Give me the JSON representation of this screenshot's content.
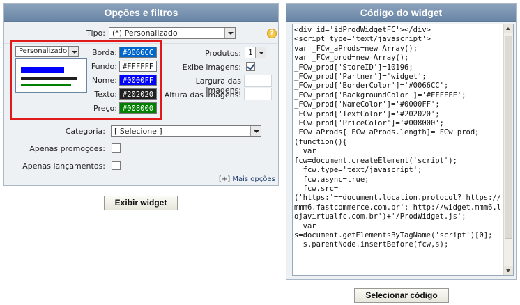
{
  "left_panel": {
    "title": "Opções e filtros",
    "tipo": {
      "label": "Tipo:",
      "value": "(*) Personalizado"
    },
    "help_icon": "?",
    "preset": {
      "value": "Personalizado"
    },
    "colors": [
      {
        "label": "Borda:",
        "value": "#0066CC",
        "hex": "#0066CC",
        "text_color": "#ffffff"
      },
      {
        "label": "Fundo:",
        "value": "#FFFFFF",
        "hex": "#FFFFFF",
        "text_color": "#111111"
      },
      {
        "label": "Nome:",
        "value": "#0000FF",
        "hex": "#0000FF",
        "text_color": "#ffffff"
      },
      {
        "label": "Texto:",
        "value": "#202020",
        "hex": "#202020",
        "text_color": "#ffffff"
      },
      {
        "label": "Preço:",
        "value": "#008000",
        "hex": "#008000",
        "text_color": "#ffffff"
      }
    ],
    "produtos": {
      "label": "Produtos:",
      "value": "1"
    },
    "exibe_imagens": {
      "label": "Exibe imagens:",
      "checked": true
    },
    "largura": {
      "label": "Largura das imagens:",
      "value": ""
    },
    "altura": {
      "label": "Altura das imagens:",
      "value": ""
    },
    "categoria": {
      "label": "Categoria:",
      "value": "[ Selecione ]"
    },
    "apenas_promocoes": {
      "label": "Apenas promoções:",
      "checked": false
    },
    "apenas_lancamentos": {
      "label": "Apenas lançamentos:",
      "checked": false
    },
    "mais_opcoes": {
      "prefix": "[+]",
      "label": "Mais opções"
    }
  },
  "exibir_widget_button": "Exibir widget",
  "right_panel": {
    "title": "Código do widget",
    "code": "<div id='idProdWidgetFC'></div>\n<script type='text/javascript'>\nvar _FCw_aProds=new Array();\nvar _FCw_prod=new Array();\n_FCw_prod['StoreID']=10196;\n_FCw_prod['Partner']='widget';\n_FCw_prod['BorderColor']='#0066CC';\n_FCw_prod['BackgroundColor']='#FFFFFF';\n_FCw_prod['NameColor']='#0000FF';\n_FCw_prod['TextColor']='#202020';\n_FCw_prod['PriceColor']='#008000';\n_FCw_aProds[_FCw_aProds.length]=_FCw_prod;\n(function(){\n  var\nfcw=document.createElement('script');\n  fcw.type='text/javascript';\n  fcw.async=true;\n  fcw.src=\n('https:'==document.location.protocol?'https://mmm6.fastcommerce.com.br':'http://widget.mmm6.lojavirtualfc.com.br')+'/ProdWidget.js';\n  var\ns=document.getElementsByTagName('script')[0];\n  s.parentNode.insertBefore(fcw,s);"
  },
  "selecionar_codigo_button": "Selecionar código"
}
